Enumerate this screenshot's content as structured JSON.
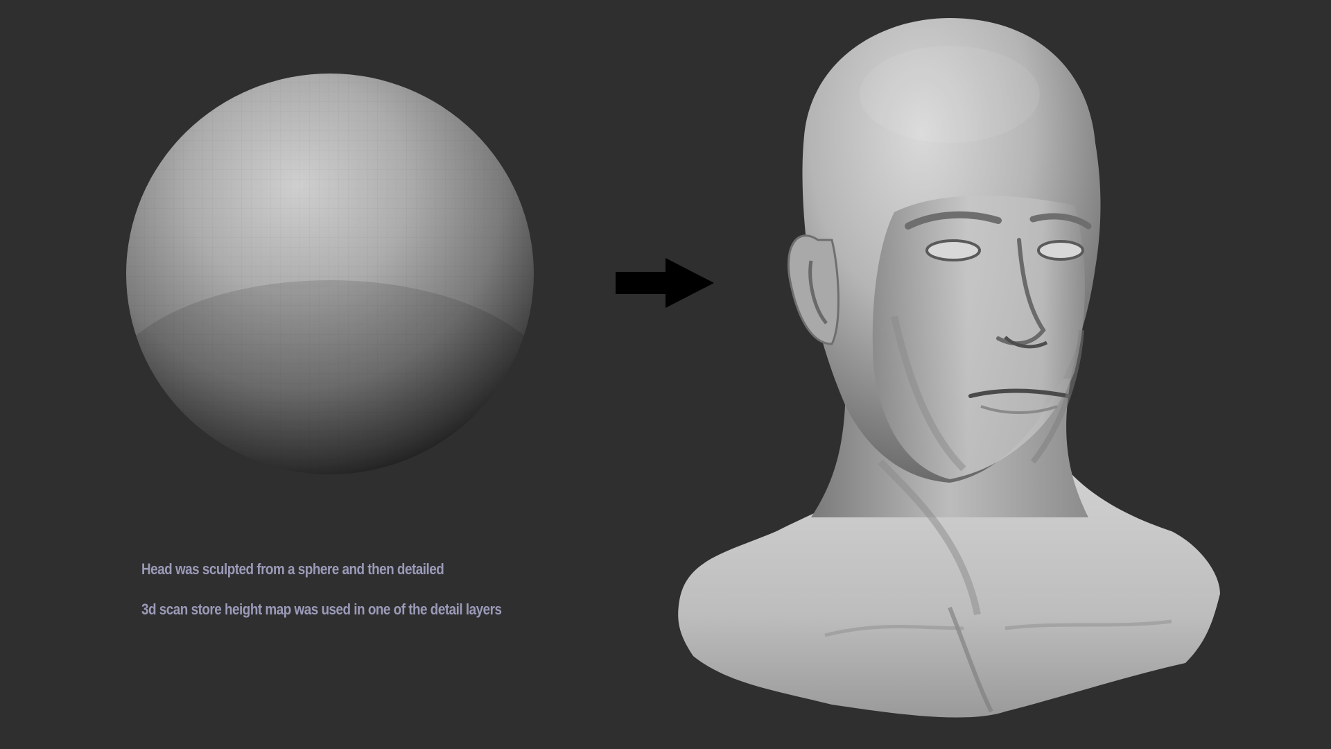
{
  "captions": {
    "line1": "Head was sculpted from a sphere and then detailed",
    "line2": "3d scan store height map was used in one of the detail layers"
  },
  "images": {
    "sphere": "base-sphere-mesh",
    "arrow": "right-arrow-icon",
    "head": "sculpted-head-bust"
  },
  "colors": {
    "background": "#2f2f30",
    "caption": "#9a9ab8",
    "arrow": "#000000",
    "clay": "#bdbdbd"
  }
}
